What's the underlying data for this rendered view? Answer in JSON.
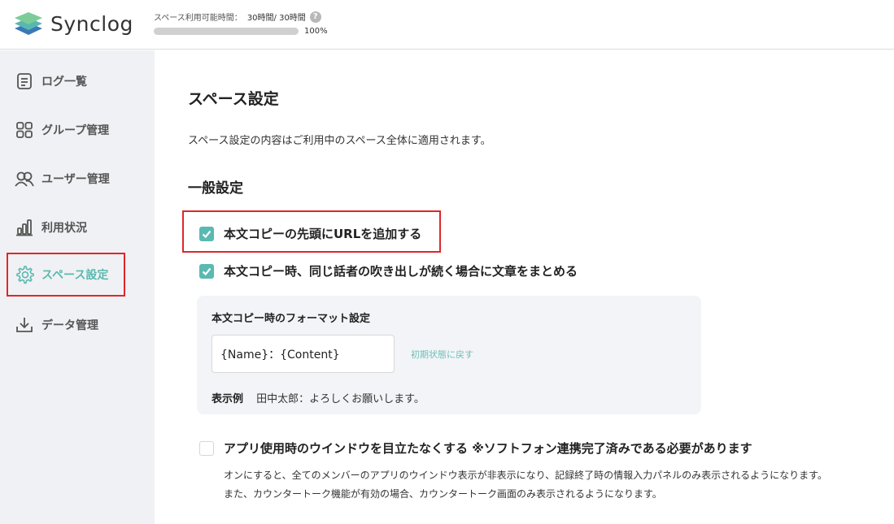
{
  "header": {
    "app_name": "Synclog",
    "usage_label": "スペース利用可能時間：",
    "usage_value": "30時間/ 30時間",
    "usage_percent_text": "100%",
    "usage_fraction": 1.0
  },
  "sidebar": {
    "items": [
      {
        "label": "ログ一覧",
        "icon": "document-list-icon",
        "active": false
      },
      {
        "label": "グループ管理",
        "icon": "grid-icon",
        "active": false
      },
      {
        "label": "ユーザー管理",
        "icon": "users-icon",
        "active": false
      },
      {
        "label": "利用状況",
        "icon": "bar-chart-icon",
        "active": false
      },
      {
        "label": "スペース設定",
        "icon": "gear-icon",
        "active": true
      },
      {
        "label": "データ管理",
        "icon": "download-tray-icon",
        "active": false
      }
    ]
  },
  "main": {
    "title": "スペース設定",
    "description": "スペース設定の内容はご利用中のスペース全体に適用されます。",
    "section_title": "一般設定",
    "options": [
      {
        "label": "本文コピーの先頭にURLを追加する",
        "checked": true
      },
      {
        "label": "本文コピー時、同じ話者の吹き出しが続く場合に文章をまとめる",
        "checked": true
      },
      {
        "label": "アプリ使用時のウインドウを目立たなくする ※ソフトフォン連携完了済みである必要があります",
        "checked": false
      }
    ],
    "format": {
      "title": "本文コピー時のフォーマット設定",
      "value": "{Name}：{Content}",
      "reset_label": "初期状態に戻す",
      "example_label": "表示例",
      "example_value": "田中太郎：よろしくお願いします。"
    },
    "notes": [
      "オンにすると、全てのメンバーのアプリのウインドウ表示が非表示になり、記録終了時の情報入力パネルのみ表示されるようになります。",
      "また、カウンタートーク機能が有効の場合、カウンタートーク画面のみ表示されるようになります。"
    ]
  },
  "colors": {
    "accent": "#5ab9b1",
    "highlight": "#e0262a",
    "sidebar_bg": "#f0f1f4"
  }
}
